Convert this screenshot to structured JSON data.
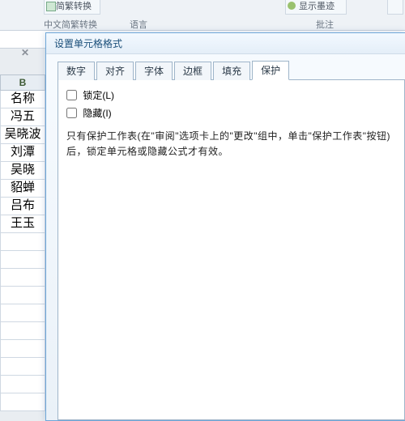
{
  "ribbon": {
    "btn_scconvert": "简繁转换",
    "group_scconvert": "中文简繁转换",
    "group_lang": "语言",
    "group_annot": "批注",
    "btn_showink": "显示墨迹"
  },
  "dialog": {
    "title": "设置单元格格式",
    "tabs": {
      "number": "数字",
      "align": "对齐",
      "font": "字体",
      "border": "边框",
      "fill": "填充",
      "protect": "保护"
    },
    "protect": {
      "locked_label": "锁定(L)",
      "hidden_label": "隐藏(I)",
      "explain": "只有保护工作表(在\"审阅\"选项卡上的\"更改\"组中，单击\"保护工作表\"按钮)后，锁定单元格或隐藏公式才有效。"
    }
  },
  "grid": {
    "column_header": "B",
    "rows": [
      "名称",
      "冯五",
      "吴晓波",
      "刘潭",
      "吴晓",
      "貂蝉",
      "吕布",
      "王玉"
    ]
  }
}
